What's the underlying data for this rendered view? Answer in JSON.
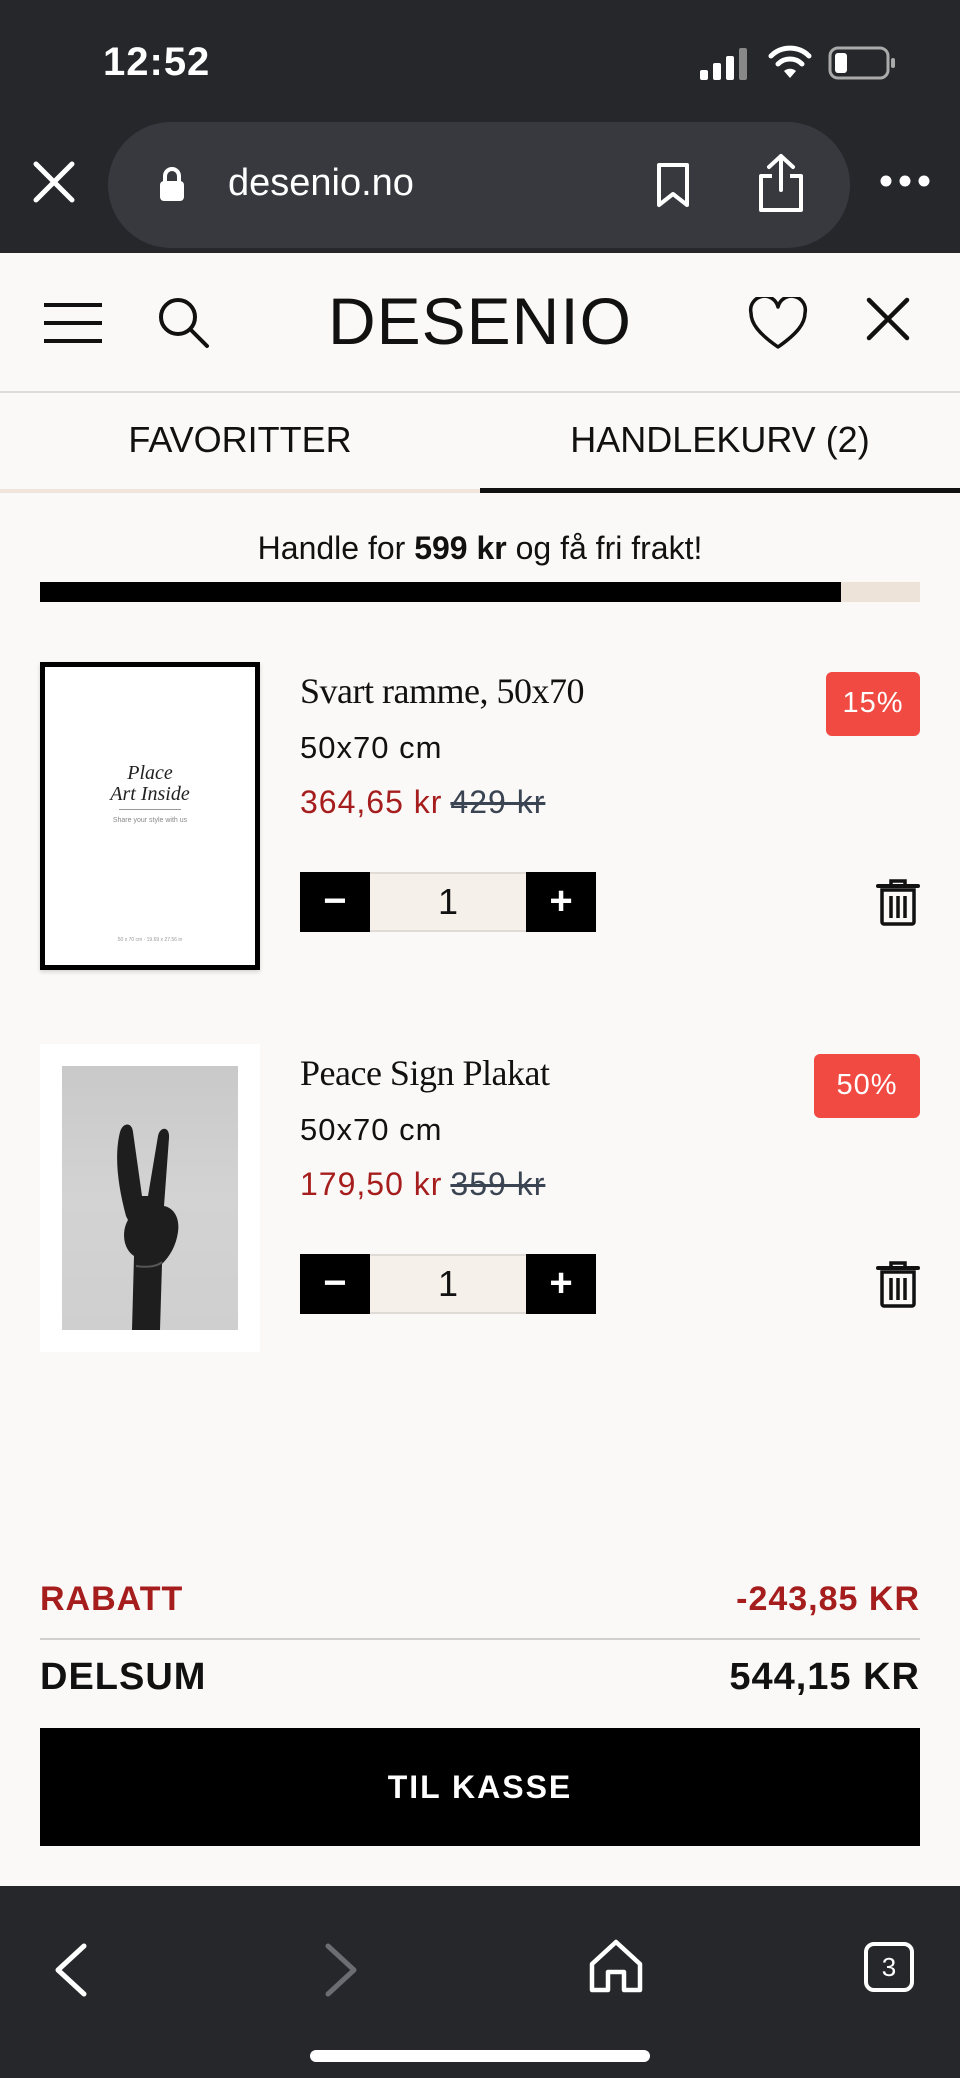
{
  "status": {
    "time": "12:52"
  },
  "browser": {
    "url": "desenio.no",
    "tabs_count": "3"
  },
  "site": {
    "logo": "DESENIO"
  },
  "tabs": [
    {
      "label": "FAVORITTER",
      "active": false
    },
    {
      "label": "HANDLEKURV (2)",
      "active": true
    }
  ],
  "shipping": {
    "prefix": "Handle for ",
    "amount": "599 kr",
    "suffix": " og få fri frakt!",
    "progress": 0.91
  },
  "cart": {
    "items": [
      {
        "name": "Svart ramme, 50x70",
        "size": "50x70 cm",
        "price": "364,65 kr",
        "old_price": "429 kr",
        "badge": "15%",
        "quantity": "1",
        "thumb_text_1": "Place",
        "thumb_text_2": "Art Inside",
        "thumb_sub": "Share your style with us",
        "thumb_foot": "50 x 70 cm · 19.69 x 27.56 in"
      },
      {
        "name": "Peace Sign Plakat",
        "size": "50x70 cm",
        "price": "179,50 kr",
        "old_price": "359 kr",
        "badge": "50%",
        "quantity": "1"
      }
    ],
    "stepper": {
      "minus": "−",
      "plus": "+"
    }
  },
  "totals": {
    "discount_label": "RABATT",
    "discount_value": "-243,85 KR",
    "subtotal_label": "DELSUM",
    "subtotal_value": "544,15 KR",
    "checkout_label": "TIL KASSE"
  },
  "colors": {
    "sale_red": "#a51d1d",
    "badge_red": "#f04a43",
    "chrome_dark": "#25272b",
    "progress_track": "#eee3d9"
  }
}
